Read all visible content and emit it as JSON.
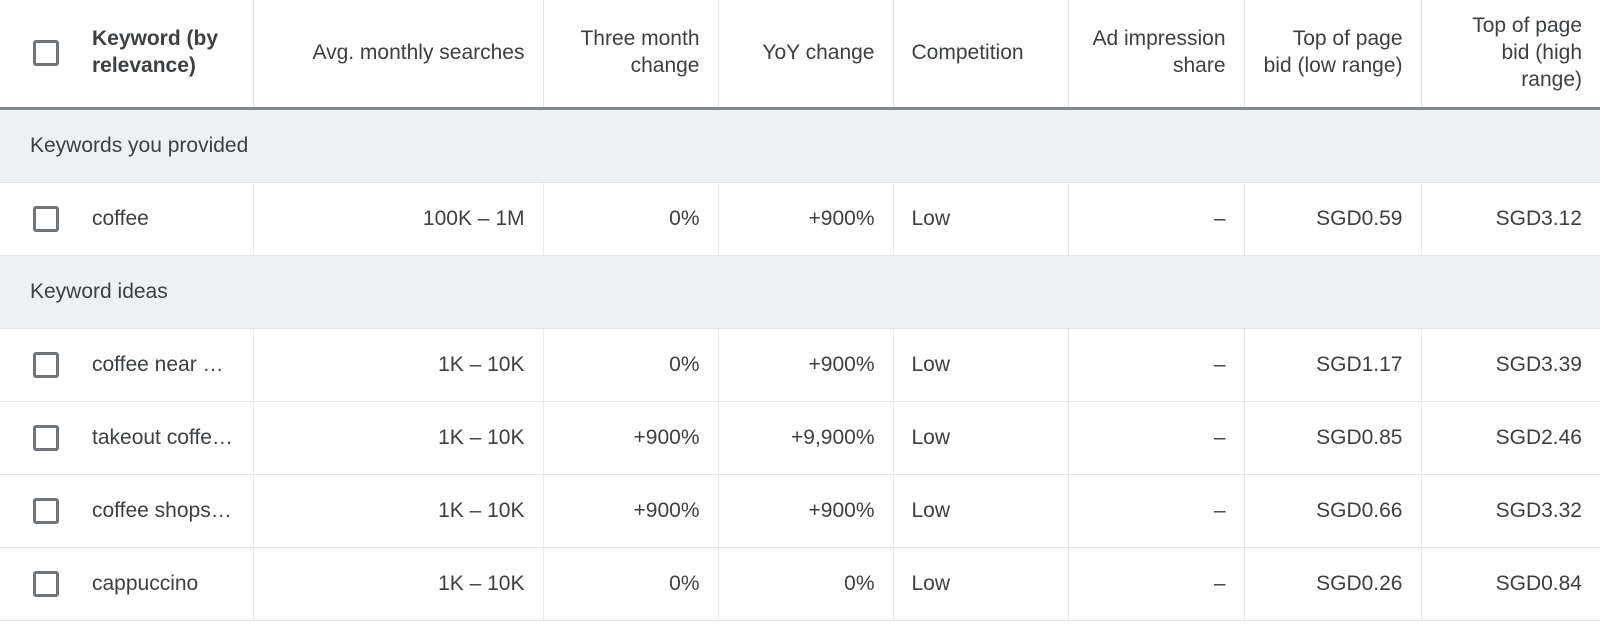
{
  "table": {
    "columns": [
      {
        "id": "checkbox",
        "label": "",
        "align": "center"
      },
      {
        "id": "keyword",
        "label": "Keyword (by relevance)",
        "align": "left"
      },
      {
        "id": "searches",
        "label": "Avg. monthly searches",
        "align": "right"
      },
      {
        "id": "three_month",
        "label": "Three month change",
        "align": "right"
      },
      {
        "id": "yoy",
        "label": "YoY change",
        "align": "right"
      },
      {
        "id": "competition",
        "label": "Competition",
        "align": "left"
      },
      {
        "id": "ad_share",
        "label": "Ad impression share",
        "align": "right"
      },
      {
        "id": "bid_low",
        "label": "Top of page bid (low range)",
        "align": "right"
      },
      {
        "id": "bid_high",
        "label": "Top of page bid (high range)",
        "align": "right"
      }
    ],
    "header_labels": {
      "keyword": "Keyword (by relevance)",
      "searches": "Avg. monthly searches",
      "three_month": "Three month change",
      "yoy": "YoY change",
      "competition": "Competition",
      "ad_share": "Ad impression share",
      "bid_low": "Top of page bid (low range)",
      "bid_high": "Top of page bid (high range)"
    },
    "sections": [
      {
        "title": "Keywords you provided",
        "rows": [
          {
            "keyword": "coffee",
            "searches": "100K – 1M",
            "three_month": "0%",
            "yoy": "+900%",
            "competition": "Low",
            "ad_share": "–",
            "bid_low": "SGD0.59",
            "bid_high": "SGD3.12"
          }
        ]
      },
      {
        "title": "Keyword ideas",
        "rows": [
          {
            "keyword": "coffee near …",
            "searches": "1K – 10K",
            "three_month": "0%",
            "yoy": "+900%",
            "competition": "Low",
            "ad_share": "–",
            "bid_low": "SGD1.17",
            "bid_high": "SGD3.39"
          },
          {
            "keyword": "takeout coffe…",
            "searches": "1K – 10K",
            "three_month": "+900%",
            "yoy": "+9,900%",
            "competition": "Low",
            "ad_share": "–",
            "bid_low": "SGD0.85",
            "bid_high": "SGD2.46"
          },
          {
            "keyword": "coffee shops…",
            "searches": "1K – 10K",
            "three_month": "+900%",
            "yoy": "+900%",
            "competition": "Low",
            "ad_share": "–",
            "bid_low": "SGD0.66",
            "bid_high": "SGD3.32"
          },
          {
            "keyword": "cappuccino",
            "searches": "1K – 10K",
            "three_month": "0%",
            "yoy": "0%",
            "competition": "Low",
            "ad_share": "–",
            "bid_low": "SGD0.26",
            "bid_high": "SGD0.84"
          }
        ]
      }
    ]
  },
  "colors": {
    "text": "#3c4043",
    "section_background": "#eef1f2",
    "grid_line": "#e3e6e8",
    "header_rule": "#80868b",
    "checkbox_border": "#70757a"
  }
}
